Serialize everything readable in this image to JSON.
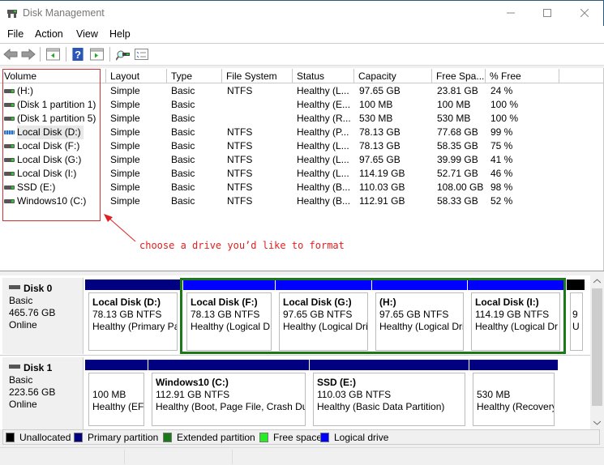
{
  "window": {
    "title": "Disk Management",
    "minimize_icon": "minimize-icon",
    "maximize_icon": "maximize-icon",
    "close_icon": "close-icon"
  },
  "menu": [
    "File",
    "Action",
    "View",
    "Help"
  ],
  "toolbar": {
    "icons": [
      "back-arrow-icon",
      "forward-arrow-icon",
      "show-hide-console-tree-icon",
      "help-icon",
      "show-action-pane-icon",
      "connect-disk-icon",
      "properties-list-icon"
    ]
  },
  "volume_list": {
    "columns": [
      "Volume",
      "Layout",
      "Type",
      "File System",
      "Status",
      "Capacity",
      "Free Spa...",
      "% Free"
    ],
    "rows": [
      {
        "volume": " (H:)",
        "layout": "Simple",
        "type": "Basic",
        "fs": "NTFS",
        "status": "Healthy (L...",
        "capacity": "97.65 GB",
        "free": "23.81 GB",
        "pct": "24 %",
        "icon": "volume-icon"
      },
      {
        "volume": "(Disk 1 partition 1)",
        "layout": "Simple",
        "type": "Basic",
        "fs": "",
        "status": "Healthy (E...",
        "capacity": "100 MB",
        "free": "100 MB",
        "pct": "100 %",
        "icon": "volume-icon"
      },
      {
        "volume": "(Disk 1 partition 5)",
        "layout": "Simple",
        "type": "Basic",
        "fs": "",
        "status": "Healthy (R...",
        "capacity": "530 MB",
        "free": "530 MB",
        "pct": "100 %",
        "icon": "volume-icon"
      },
      {
        "volume": "Local Disk (D:)",
        "layout": "Simple",
        "type": "Basic",
        "fs": "NTFS",
        "status": "Healthy (P...",
        "capacity": "78.13 GB",
        "free": "77.68 GB",
        "pct": "99 %",
        "icon": "volume-striped-icon"
      },
      {
        "volume": "Local Disk (F:)",
        "layout": "Simple",
        "type": "Basic",
        "fs": "NTFS",
        "status": "Healthy (L...",
        "capacity": "78.13 GB",
        "free": "58.35 GB",
        "pct": "75 %",
        "icon": "volume-icon"
      },
      {
        "volume": "Local Disk (G:)",
        "layout": "Simple",
        "type": "Basic",
        "fs": "NTFS",
        "status": "Healthy (L...",
        "capacity": "97.65 GB",
        "free": "39.99 GB",
        "pct": "41 %",
        "icon": "volume-icon"
      },
      {
        "volume": "Local Disk (I:)",
        "layout": "Simple",
        "type": "Basic",
        "fs": "NTFS",
        "status": "Healthy (L...",
        "capacity": "114.19 GB",
        "free": "52.71 GB",
        "pct": "46 %",
        "icon": "volume-icon"
      },
      {
        "volume": "SSD (E:)",
        "layout": "Simple",
        "type": "Basic",
        "fs": "NTFS",
        "status": "Healthy (B...",
        "capacity": "110.03 GB",
        "free": "108.00 GB",
        "pct": "98 %",
        "icon": "volume-icon"
      },
      {
        "volume": "Windows10 (C:)",
        "layout": "Simple",
        "type": "Basic",
        "fs": "NTFS",
        "status": "Healthy (B...",
        "capacity": "112.91 GB",
        "free": "58.33 GB",
        "pct": "52 %",
        "icon": "volume-icon"
      }
    ]
  },
  "annotation": {
    "text": "choose a drive you’d like to format",
    "color": "#e02020"
  },
  "disks": [
    {
      "name": "Disk 0",
      "type": "Basic",
      "size": "465.76 GB",
      "status": "Online",
      "partitions": [
        {
          "name": "Local Disk  (D:)",
          "size": "78.13 GB NTFS",
          "status": "Healthy (Primary Pa",
          "kind": "primary"
        },
        {
          "name": "Local Disk  (F:)",
          "size": "78.13 GB NTFS",
          "status": "Healthy (Logical D",
          "kind": "logical"
        },
        {
          "name": "Local Disk  (G:)",
          "size": "97.65 GB NTFS",
          "status": "Healthy (Logical Dri",
          "kind": "logical"
        },
        {
          "name": " (H:)",
          "size": "97.65 GB NTFS",
          "status": "Healthy (Logical Dri",
          "kind": "logical"
        },
        {
          "name": "Local Disk  (I:)",
          "size": "114.19 GB NTFS",
          "status": "Healthy (Logical Dr",
          "kind": "logical"
        },
        {
          "name": "",
          "size": "9",
          "status": "U",
          "kind": "unallocated"
        }
      ]
    },
    {
      "name": "Disk 1",
      "type": "Basic",
      "size": "223.56 GB",
      "status": "Online",
      "partitions": [
        {
          "name": "",
          "size": "100 MB",
          "status": "Healthy (EFI",
          "kind": "primary"
        },
        {
          "name": "Windows10  (C:)",
          "size": "112.91 GB NTFS",
          "status": "Healthy (Boot, Page File, Crash Dui",
          "kind": "primary"
        },
        {
          "name": "SSD  (E:)",
          "size": "110.03 GB NTFS",
          "status": "Healthy (Basic Data Partition)",
          "kind": "primary"
        },
        {
          "name": "",
          "size": "530 MB",
          "status": "Healthy (Recovery",
          "kind": "primary"
        }
      ]
    }
  ],
  "legend": [
    {
      "label": "Unallocated",
      "color": "#000000"
    },
    {
      "label": "Primary partition",
      "color": "#000080"
    },
    {
      "label": "Extended partition",
      "color": "#1a7a1a"
    },
    {
      "label": "Free space",
      "color": "#22ee22"
    },
    {
      "label": "Logical drive",
      "color": "#0000ff"
    }
  ],
  "colors": {
    "primary": "#000080",
    "logical": "#0000ff",
    "unallocated": "#000000",
    "extended": "#1a7a1a",
    "highlight_box": "#d43030"
  }
}
